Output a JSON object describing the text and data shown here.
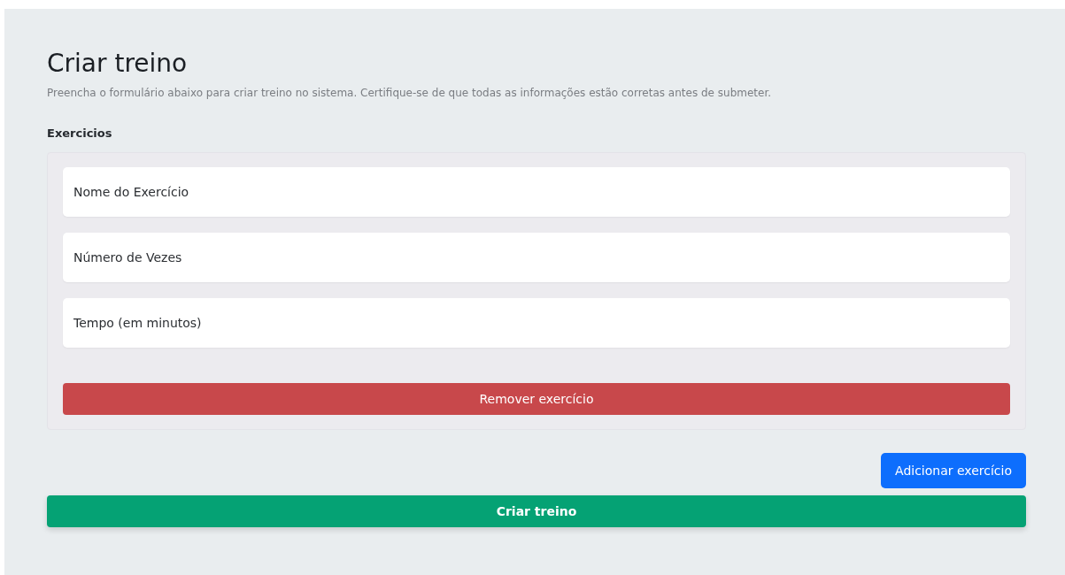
{
  "title": "Criar treino",
  "description": "Preencha o formulário abaixo para criar treino no sistema. Certifique-se de que todas as informações estão corretas antes de submeter.",
  "section_label": "Exercicios",
  "exercise_fields": [
    {
      "placeholder": "Nome do Exercício"
    },
    {
      "placeholder": "Número de Vezes"
    },
    {
      "placeholder": "Tempo (em minutos)"
    }
  ],
  "remove_button": "Remover exercício",
  "add_button": "Adicionar exercício",
  "submit_button": "Criar treino"
}
